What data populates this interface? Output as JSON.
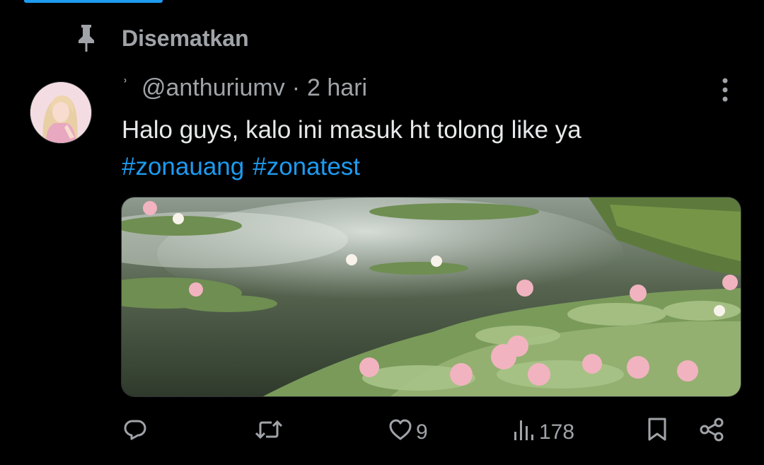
{
  "pinned": {
    "label": "Disematkan",
    "icon": "pin-icon"
  },
  "tweet": {
    "name_mark": "ʾ",
    "handle": "@anthuriumv",
    "separator": "·",
    "time": "2 hari",
    "text": "Halo guys, kalo ini masuk ht tolong like ya",
    "hashtags": [
      "#zonauang",
      "#zonatest"
    ],
    "media_alt": "",
    "more_icon": "more-vertical-icon"
  },
  "actions": {
    "reply": {
      "icon": "reply-icon",
      "count": ""
    },
    "retweet": {
      "icon": "retweet-icon",
      "count": ""
    },
    "like": {
      "icon": "heart-icon",
      "count": "9"
    },
    "views": {
      "icon": "views-icon",
      "count": "178"
    },
    "bookmark": {
      "icon": "bookmark-icon"
    },
    "share": {
      "icon": "share-icon"
    }
  },
  "colors": {
    "background": "#000000",
    "text": "#e7e9ea",
    "muted": "#a0a4a8",
    "accent": "#1d9bf0"
  }
}
